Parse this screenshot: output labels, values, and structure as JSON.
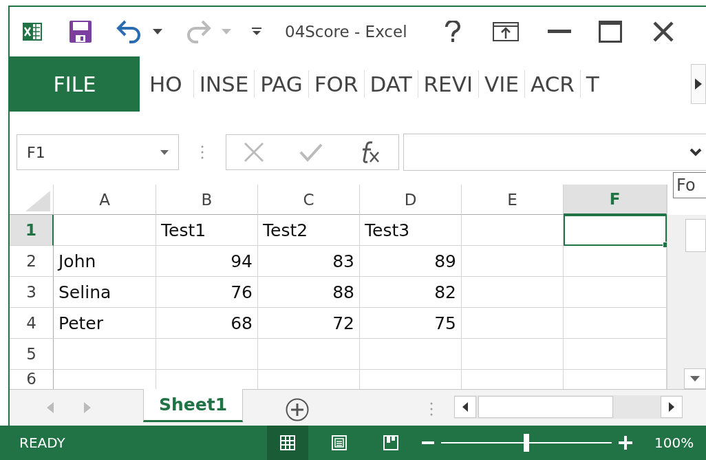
{
  "title_bar": {
    "title": "04Score - Excel"
  },
  "ribbon_tabs": [
    {
      "label": "FILE",
      "kind": "file",
      "selected": false
    },
    {
      "label": "HO",
      "kind": "tab",
      "selected": false
    },
    {
      "label": "INSE",
      "kind": "tab",
      "selected": false
    },
    {
      "label": "PAG",
      "kind": "tab",
      "selected": false
    },
    {
      "label": "FOR",
      "kind": "tab",
      "selected": false
    },
    {
      "label": "DAT",
      "kind": "tab",
      "selected": false
    },
    {
      "label": "REVI",
      "kind": "tab",
      "selected": false
    },
    {
      "label": "VIE",
      "kind": "tab",
      "selected": false
    },
    {
      "label": "ACR",
      "kind": "tab",
      "selected": false
    },
    {
      "label": "T",
      "kind": "tab",
      "selected": false
    }
  ],
  "name_box": {
    "value": "F1"
  },
  "tooltip": "Fo",
  "columns": [
    {
      "label": "A",
      "selected": false
    },
    {
      "label": "B",
      "selected": false
    },
    {
      "label": "C",
      "selected": false
    },
    {
      "label": "D",
      "selected": false
    },
    {
      "label": "E",
      "selected": false
    },
    {
      "label": "F",
      "selected": true
    }
  ],
  "rows": [
    {
      "label": "1",
      "selected": true,
      "cells": [
        {
          "kind": "empty",
          "selected": false
        },
        {
          "text": "Test1",
          "kind": "text",
          "selected": false
        },
        {
          "text": "Test2",
          "kind": "text",
          "selected": false
        },
        {
          "text": "Test3",
          "kind": "text",
          "selected": false
        },
        {
          "kind": "empty",
          "selected": false
        },
        {
          "kind": "empty",
          "selected": true
        }
      ]
    },
    {
      "label": "2",
      "selected": false,
      "cells": [
        {
          "text": "John",
          "kind": "text",
          "selected": false
        },
        {
          "text": "94",
          "kind": "number",
          "selected": false
        },
        {
          "text": "83",
          "kind": "number",
          "selected": false
        },
        {
          "text": "89",
          "kind": "number",
          "selected": false
        },
        {
          "kind": "empty",
          "selected": false
        },
        {
          "kind": "empty",
          "selected": false
        }
      ]
    },
    {
      "label": "3",
      "selected": false,
      "cells": [
        {
          "text": "Selina",
          "kind": "text",
          "selected": false
        },
        {
          "text": "76",
          "kind": "number",
          "selected": false
        },
        {
          "text": "88",
          "kind": "number",
          "selected": false
        },
        {
          "text": "82",
          "kind": "number",
          "selected": false
        },
        {
          "kind": "empty",
          "selected": false
        },
        {
          "kind": "empty",
          "selected": false
        }
      ]
    },
    {
      "label": "4",
      "selected": false,
      "cells": [
        {
          "text": "Peter",
          "kind": "text",
          "selected": false
        },
        {
          "text": "68",
          "kind": "number",
          "selected": false
        },
        {
          "text": "72",
          "kind": "number",
          "selected": false
        },
        {
          "text": "75",
          "kind": "number",
          "selected": false
        },
        {
          "kind": "empty",
          "selected": false
        },
        {
          "kind": "empty",
          "selected": false
        }
      ]
    },
    {
      "label": "5",
      "selected": false,
      "cells": [
        {
          "kind": "empty",
          "selected": false
        },
        {
          "kind": "empty",
          "selected": false
        },
        {
          "kind": "empty",
          "selected": false
        },
        {
          "kind": "empty",
          "selected": false
        },
        {
          "kind": "empty",
          "selected": false
        },
        {
          "kind": "empty",
          "selected": false
        }
      ]
    },
    {
      "label": "6",
      "selected": false,
      "cells": [
        {
          "kind": "empty",
          "selected": false
        },
        {
          "kind": "empty",
          "selected": false
        },
        {
          "kind": "empty",
          "selected": false
        },
        {
          "kind": "empty",
          "selected": false
        },
        {
          "kind": "empty",
          "selected": false
        },
        {
          "kind": "empty",
          "selected": false
        }
      ]
    }
  ],
  "sheet_tabs": [
    {
      "label": "Sheet1",
      "selected": true
    }
  ],
  "status_bar": {
    "status": "READY",
    "zoom": "100%",
    "zoom_slider": {
      "level": 0.5
    },
    "views": [
      {
        "kind": "normal",
        "selected": true
      },
      {
        "kind": "page-layout",
        "selected": false
      },
      {
        "kind": "page-break",
        "selected": false
      }
    ]
  }
}
